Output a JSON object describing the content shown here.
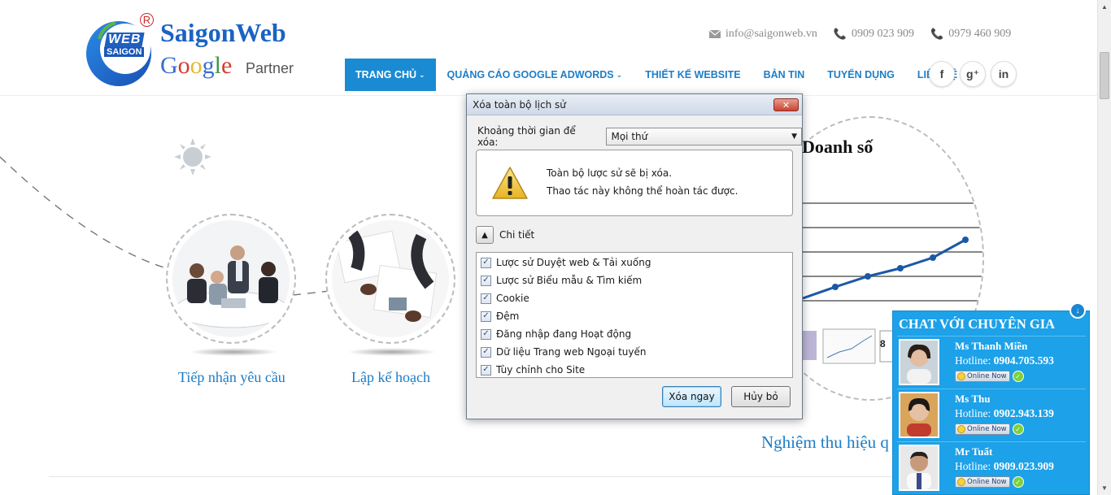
{
  "header": {
    "logo": {
      "web_text": "WEB",
      "saigon_text": "SAIGON",
      "reg_mark": "R",
      "brand": "SaigonWeb",
      "google_letters": [
        "G",
        "o",
        "o",
        "g",
        "l",
        "e"
      ],
      "partner": "Partner"
    },
    "contacts": [
      {
        "icon": "envelope-icon",
        "text": "info@saigonweb.vn"
      },
      {
        "icon": "phone-icon",
        "text": "0909 023 909"
      },
      {
        "icon": "phone-icon",
        "text": "0979 460 909"
      }
    ],
    "nav": [
      {
        "label": "TRANG CHỦ",
        "caret": "⌄",
        "active": true
      },
      {
        "label": "QUẢNG CÁO GOOGLE ADWORDS",
        "caret": "⌄",
        "active": false
      },
      {
        "label": "THIẾT KẾ WEBSITE",
        "active": false
      },
      {
        "label": "BẢN TIN",
        "active": false
      },
      {
        "label": "TUYỂN DỤNG",
        "active": false
      },
      {
        "label": "LIÊN HỆ",
        "active": false
      }
    ],
    "socials": [
      {
        "icon": "facebook-icon",
        "glyph": "f"
      },
      {
        "icon": "google-plus-icon",
        "glyph": "g⁺"
      },
      {
        "icon": "linkedin-icon",
        "glyph": "in"
      }
    ]
  },
  "content": {
    "steps": [
      {
        "label": "Tiếp nhận yêu cầu"
      },
      {
        "label": "Lập kế hoạch"
      }
    ],
    "chart_title": "Doanh số",
    "chart_caption_partial": "Doanh số",
    "result_label": "Nghiệm thu hiệu q"
  },
  "dialog": {
    "title": "Xóa toàn bộ lịch sử",
    "close_glyph": "✕",
    "range_label": "Khoảng thời gian để xóa:",
    "range_value": "Mọi thứ",
    "warning_line1": "Toàn bộ lược sử sẽ bị xóa.",
    "warning_line2": "Thao tác này không thể hoàn tác được.",
    "details_label": "Chi tiết",
    "items": [
      {
        "label": "Lược sử Duyệt web & Tải xuống",
        "checked": true
      },
      {
        "label": "Lược sử Biểu mẫu & Tìm kiếm",
        "checked": true
      },
      {
        "label": "Cookie",
        "checked": true
      },
      {
        "label": "Đệm",
        "checked": true
      },
      {
        "label": "Đăng nhập đang Hoạt động",
        "checked": true
      },
      {
        "label": "Dữ liệu Trang web Ngoại tuyến",
        "checked": true
      },
      {
        "label": "Tùy chỉnh cho Site",
        "checked": true
      }
    ],
    "confirm_label": "Xóa ngay",
    "cancel_label": "Hủy bỏ"
  },
  "chat": {
    "title": "CHAT VỚI CHUYÊN GIA",
    "agents": [
      {
        "name": "Ms Thanh Miền",
        "hotline_label": "Hotline:",
        "hotline": "0904.705.593",
        "status": "Online Now"
      },
      {
        "name": "Ms Thu",
        "hotline_label": "Hotline:",
        "hotline": "0902.943.139",
        "status": "Online Now"
      },
      {
        "name": "Mr Tuất",
        "hotline_label": "Hotline:",
        "hotline": "0909.023.909",
        "status": "Online Now"
      }
    ]
  },
  "colors": {
    "accent": "#1a8bd2",
    "link": "#1d7ec8",
    "chat_bg": "#1da1e8"
  }
}
